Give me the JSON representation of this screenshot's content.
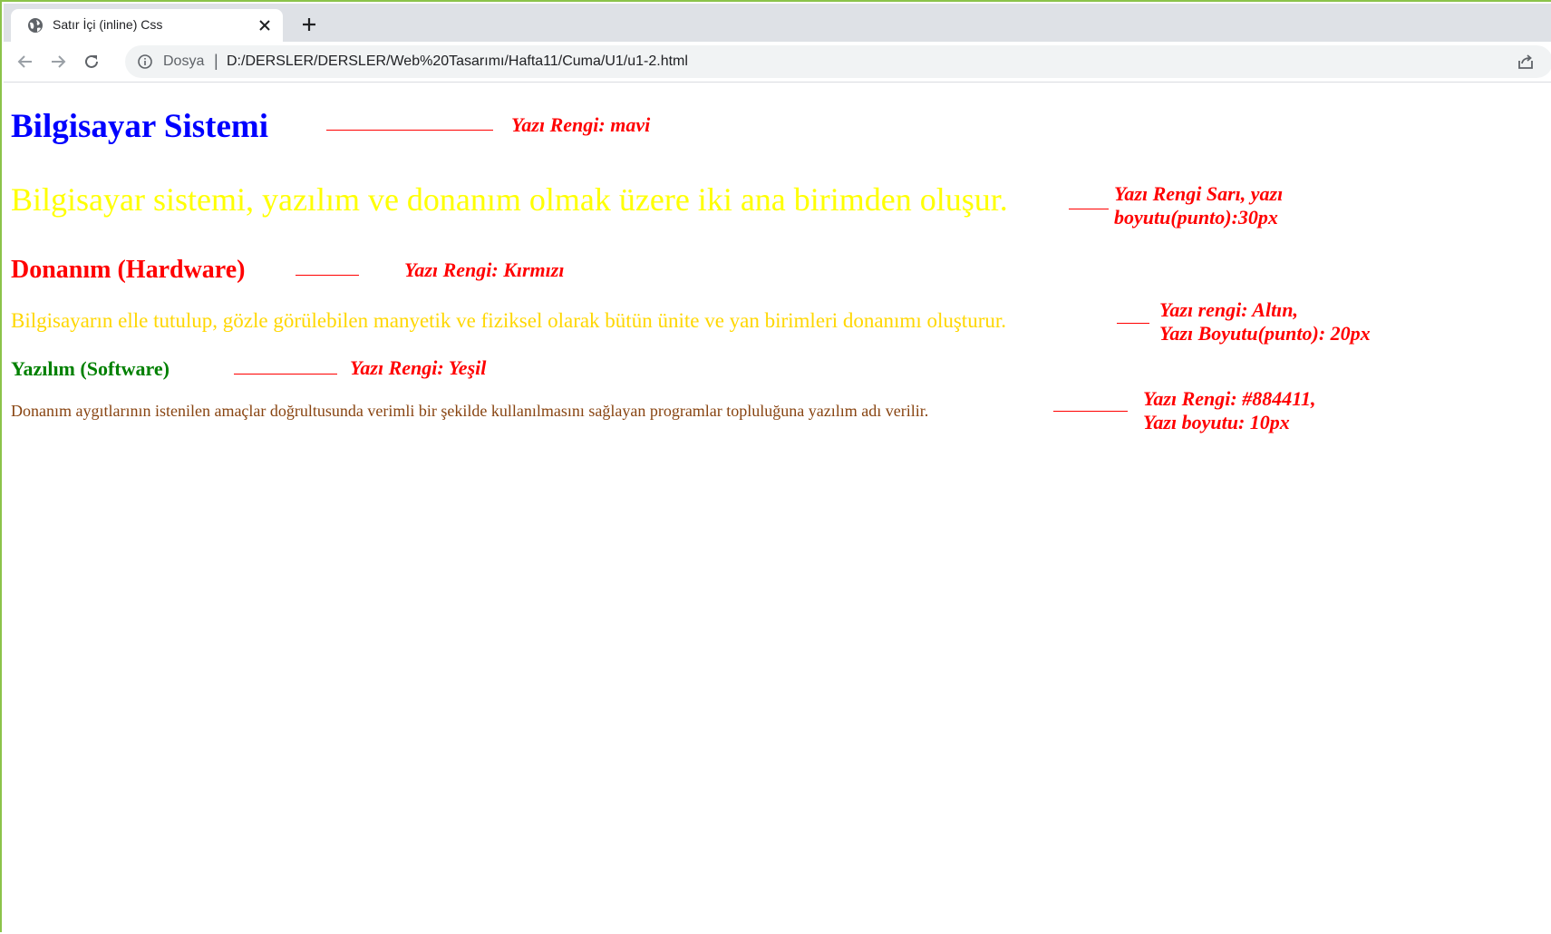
{
  "browser": {
    "tab_title": "Satır İçi (inline) Css",
    "omnibox": {
      "scheme_label": "Dosya",
      "separator": "|",
      "url": "D:/DERSLER/DERSLER/Web%20Tasarımı/Hafta11/Cuma/U1/u1-2.html"
    },
    "icons": {
      "favicon": "globe-icon",
      "close": "close-icon",
      "new_tab": "plus-icon",
      "back": "back-arrow-icon",
      "forward": "forward-arrow-icon",
      "reload": "reload-icon",
      "info": "info-icon",
      "share": "share-icon"
    }
  },
  "page": {
    "h1": {
      "text": "Bilgisayar Sistemi",
      "color": "#0000ff"
    },
    "p1": {
      "text": "Bilgisayar sistemi, yazılım ve donanım olmak üzere iki ana birimden oluşur.",
      "color": "#ffff00"
    },
    "h2": {
      "text": "Donanım (Hardware)",
      "color": "#ff0000"
    },
    "p2": {
      "text": "Bilgisayarın elle tutulup, gözle görülebilen manyetik ve fiziksel olarak bütün ünite ve yan birimleri donanımı oluşturur.",
      "color": "#ffd700"
    },
    "h3": {
      "text": "Yazılım (Software)",
      "color": "#008000"
    },
    "p3": {
      "text": "Donanım aygıtlarının istenilen amaçlar doğrultusunda verimli bir şekilde kullanılmasını sağlayan programlar topluluğuna yazılım adı verilir.",
      "color": "#884411"
    }
  },
  "annotations": {
    "color": "#ff0000",
    "a1": {
      "line1": "Yazı Rengi: mavi"
    },
    "a2": {
      "line1": "Yazı Rengi Sarı, yazı",
      "line2": "boyutu(punto):30px"
    },
    "a3": {
      "line1": "Yazı Rengi: Kırmızı"
    },
    "a4": {
      "line1": "Yazı rengi: Altın,",
      "line2": "Yazı Boyutu(punto): 20px"
    },
    "a5": {
      "line1": "Yazı Rengi: Yeşil"
    },
    "a6": {
      "line1": "Yazı Rengi: #884411,",
      "line2": "Yazı boyutu: 10px"
    }
  }
}
